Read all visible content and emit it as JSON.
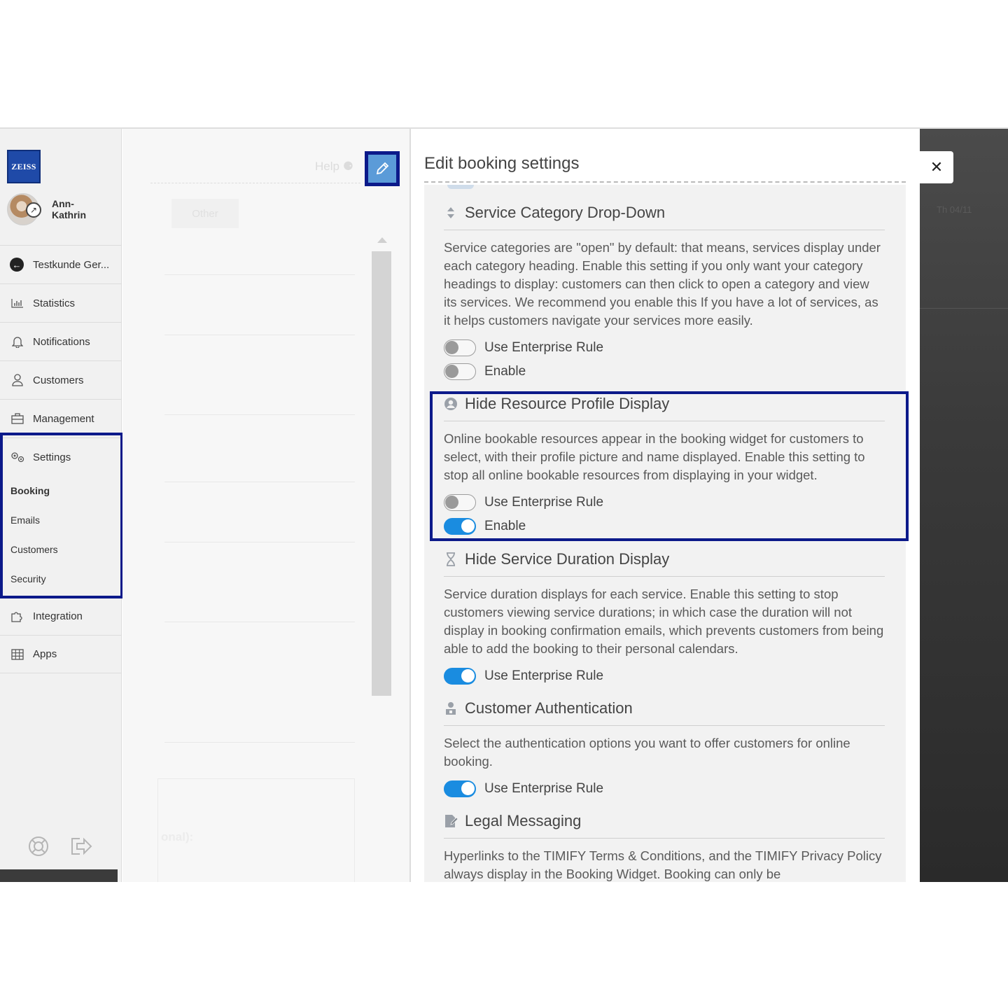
{
  "brand": {
    "logo_text": "ZEISS"
  },
  "user": {
    "name": "Ann-\nKathrin"
  },
  "sidebar": {
    "back_item": "Testkunde Ger...",
    "items": [
      {
        "label": "Statistics",
        "icon": "bar-chart-icon"
      },
      {
        "label": "Notifications",
        "icon": "bell-icon"
      },
      {
        "label": "Customers",
        "icon": "person-icon"
      },
      {
        "label": "Management",
        "icon": "briefcase-icon"
      }
    ],
    "settings": {
      "label": "Settings",
      "icon": "gears-icon",
      "sub_items": [
        "Booking",
        "Emails",
        "Customers",
        "Security"
      ],
      "active": "Booking"
    },
    "after_items": [
      {
        "label": "Integration",
        "icon": "puzzle-icon"
      },
      {
        "label": "Apps",
        "icon": "grid-icon"
      }
    ],
    "footer_icons": [
      "lifebuoy-icon",
      "logout-icon"
    ]
  },
  "middle": {
    "help_label": "Help",
    "other_chip": "Other",
    "ghost_text": "onal):"
  },
  "overlay": {
    "date_text": "Th 04/11"
  },
  "panel": {
    "title": "Edit booking settings",
    "sections": [
      {
        "title": "Service Category Drop-Down",
        "icon": "sort-icon",
        "description": "Service categories are \"open\" by default: that means, services display under each category heading. Enable this setting if you only want your category headings to display: customers can then click to open a category and view its services. We recommend you enable this If you have a lot of services, as it helps customers navigate your services more easily.",
        "toggles": [
          {
            "label": "Use Enterprise Rule",
            "on": false
          },
          {
            "label": "Enable",
            "on": false
          }
        ]
      },
      {
        "title": "Hide Resource Profile Display",
        "icon": "user-circle-icon",
        "description": "Online bookable resources appear in the booking widget for customers to select, with their profile picture and name displayed. Enable this setting to stop all online bookable resources from displaying in your widget.",
        "toggles": [
          {
            "label": "Use Enterprise Rule",
            "on": false
          },
          {
            "label": "Enable",
            "on": true
          }
        ]
      },
      {
        "title": "Hide Service Duration Display",
        "icon": "hourglass-icon",
        "description": "Service duration displays for each service. Enable this setting to stop customers viewing service durations; in which case the duration will not display in booking confirmation emails, which prevents customers from being able to add the booking to their personal calendars.",
        "toggles": [
          {
            "label": "Use Enterprise Rule",
            "on": true
          }
        ]
      },
      {
        "title": "Customer Authentication",
        "icon": "user-lock-icon",
        "description": "Select the authentication options you want to offer customers for online booking.",
        "toggles": [
          {
            "label": "Use Enterprise Rule",
            "on": true
          }
        ]
      },
      {
        "title": "Legal Messaging",
        "icon": "document-edit-icon",
        "description": "Hyperlinks to the TIMIFY Terms & Conditions, and the TIMIFY Privacy Policy always display in the Booking Widget. Booking can only be",
        "toggles": []
      }
    ]
  },
  "colors": {
    "accent": "#1a8ce0",
    "highlight": "#0c1a8a",
    "logo": "#1f4aa8"
  }
}
